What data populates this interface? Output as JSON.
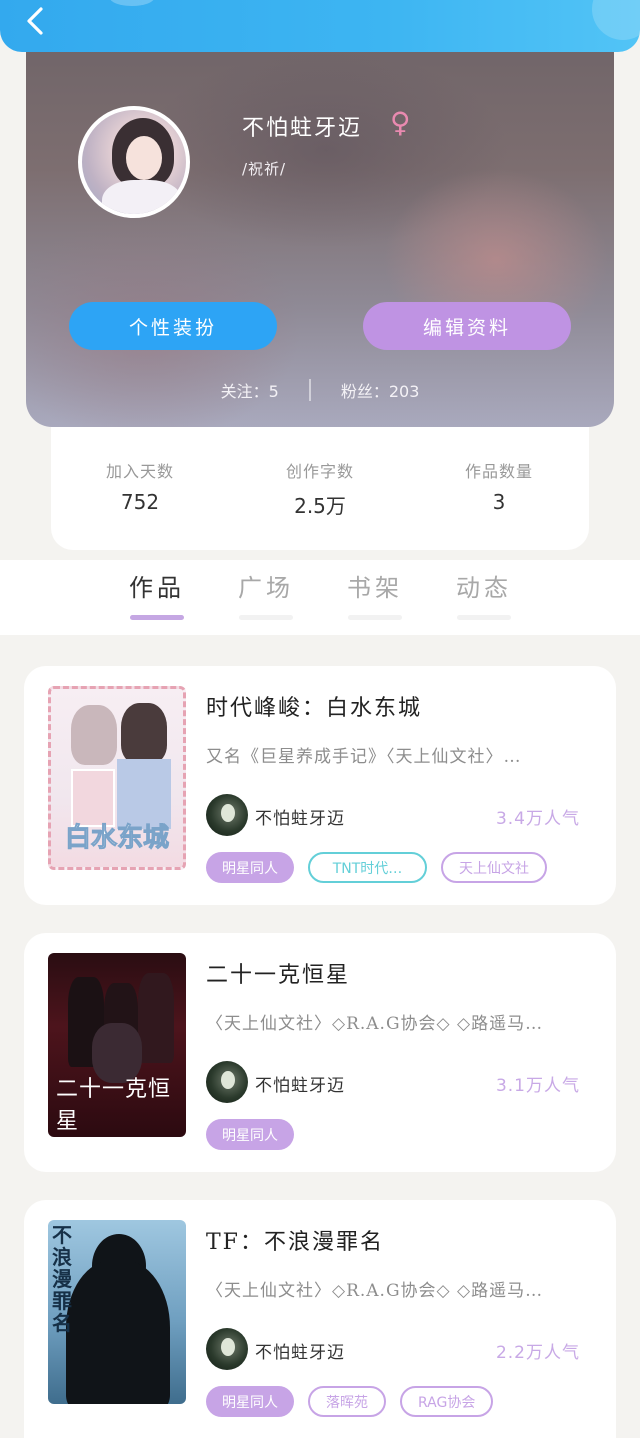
{
  "profile": {
    "username": "不怕蛀牙迈",
    "gender_symbol": "♀",
    "signature": "/祝祈/",
    "buttons": {
      "dress_up": "个性装扮",
      "edit_profile": "编辑资料"
    },
    "following_label": "关注：",
    "following_count": "5",
    "fans_label": "粉丝：",
    "fans_count": "203"
  },
  "stats": [
    {
      "label": "加入天数",
      "value": "752"
    },
    {
      "label": "创作字数",
      "value": "2.5万"
    },
    {
      "label": "作品数量",
      "value": "3"
    }
  ],
  "tabs": [
    {
      "label": "作品",
      "active": true
    },
    {
      "label": "广场",
      "active": false
    },
    {
      "label": "书架",
      "active": false
    },
    {
      "label": "动态",
      "active": false
    }
  ],
  "works": [
    {
      "title": "时代峰峻：白水东城",
      "description": "又名《巨星养成手记》〈天上仙文社〉…",
      "cover_text": "白水东城",
      "author": "不怕蛀牙迈",
      "popularity": "3.4万人气",
      "tags": [
        "明星同人",
        "TNT时代…",
        "天上仙文社"
      ]
    },
    {
      "title": "二十一克恒星",
      "description": "〈天上仙文社〉◇R.A.G协会◇ ◇路遥马…",
      "cover_text": "二十一克恒星",
      "author": "不怕蛀牙迈",
      "popularity": "3.1万人气",
      "tags": [
        "明星同人"
      ]
    },
    {
      "title": "TF：不浪漫罪名",
      "description": "〈天上仙文社〉◇R.A.G协会◇ ◇路遥马…",
      "cover_text": "不浪漫罪名",
      "author": "不怕蛀牙迈",
      "popularity": "2.2万人气",
      "tags": [
        "明星同人",
        "落晖苑",
        "RAG协会"
      ]
    }
  ],
  "colors": {
    "topbar": "#3db5f2",
    "dress_button": "#2da4f5",
    "edit_button": "#bf93e3",
    "tab_underline": "#c5a7e3",
    "tag_fill": "#c7a4e6",
    "tag_cyan": "#63cfd8",
    "popularity": "#c8a9e6"
  },
  "icons": {
    "back": "chevron-left-icon",
    "gender": "female-icon"
  }
}
